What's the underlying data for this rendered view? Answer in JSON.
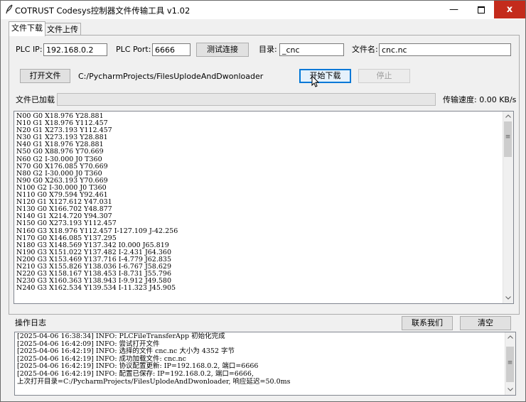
{
  "window": {
    "title": "COTRUST Codesys控制器文件传输工具 v1.02",
    "min_label": "—",
    "close_label": "x"
  },
  "tabs": [
    {
      "label": "文件下载",
      "active": true
    },
    {
      "label": "文件上传",
      "active": false
    }
  ],
  "connection": {
    "ip_label": "PLC IP:",
    "ip_value": "192.168.0.2",
    "port_label": "PLC Port:",
    "port_value": "6666",
    "test_button": "测试连接",
    "dir_label": "目录:",
    "dir_value": "_cnc",
    "filename_label": "文件名:",
    "filename_value": "cnc.nc"
  },
  "file": {
    "open_button": "打开文件",
    "path": "C:/PycharmProjects/FilesUplodeAndDwonloader",
    "start_button": "开始下载",
    "stop_button": "停止"
  },
  "progress": {
    "label": "文件已加载",
    "value": 0,
    "speed_text": "传输速度: 0.00 KB/s"
  },
  "gcode_lines": [
    "N00 G0 X18.976 Y28.881",
    "N10 G1 X18.976 Y112.457",
    "N20 G1 X273.193 Y112.457",
    "N30 G1 X273.193 Y28.881",
    "N40 G1 X18.976 Y28.881",
    "N50 G0 X88.976 Y70.669",
    "N60 G2 I-30.000 J0 T360",
    "N70 G0 X176.085 Y70.669",
    "N80 G2 I-30.000 J0 T360",
    "N90 G0 X263.193 Y70.669",
    "N100 G2 I-30.000 J0 T360",
    "N110 G0 X79.594 Y92.461",
    "N120 G1 X127.612 Y47.031",
    "N130 G0 X166.702 Y48.877",
    "N140 G1 X214.720 Y94.307",
    "N150 G0 X273.193 Y112.457",
    "N160 G3 X18.976 Y112.457 I-127.109 J-42.256",
    "N170 G0 X146.085 Y137.295",
    "N180 G3 X148.569 Y137.342 I0.000 J65.819",
    "N190 G3 X151.022 Y137.482 I-2.431 J64.360",
    "N200 G3 X153.469 Y137.716 I-4.779 J62.835",
    "N210 G3 X155.826 Y138.036 I-6.767 J58.629",
    "N220 G3 X158.167 Y138.453 I-8.731 J55.796",
    "N230 G3 X160.363 Y138.943 I-9.912 J49.580",
    "N240 G3 X162.534 Y139.534 I-11.323 J45.905"
  ],
  "log": {
    "label": "操作日志",
    "contact_button": "联系我们",
    "clear_button": "清空",
    "lines": [
      "[2025-04-06 16:38:34] INFO: PLCFileTransferApp 初始化完成",
      "[2025-04-06 16:42:09] INFO: 尝试打开文件",
      "[2025-04-06 16:42:19] INFO: 选择的文件 cnc.nc 大小为 4352 字节",
      "[2025-04-06 16:42:19] INFO: 成功加载文件: cnc.nc",
      "[2025-04-06 16:42:19] INFO: 协议配置更新: IP=192.168.0.2, 端口=6666",
      "[2025-04-06 16:42:19] INFO: 配置已保存: IP=192.168.0.2, 端口=6666,",
      "上次打开目录=C:/PycharmProjects/FilesUplodeAndDwonloader, 响应延迟=50.0ms"
    ]
  },
  "icons": {
    "app": "feather-icon",
    "scroll_up": "chevron-up-icon",
    "scroll_down": "chevron-down-icon",
    "grip": "grip-icon"
  },
  "colors": {
    "close_button": "#c42b1c",
    "focus_border": "#0078d7",
    "window_bg": "#f0f0f0"
  }
}
